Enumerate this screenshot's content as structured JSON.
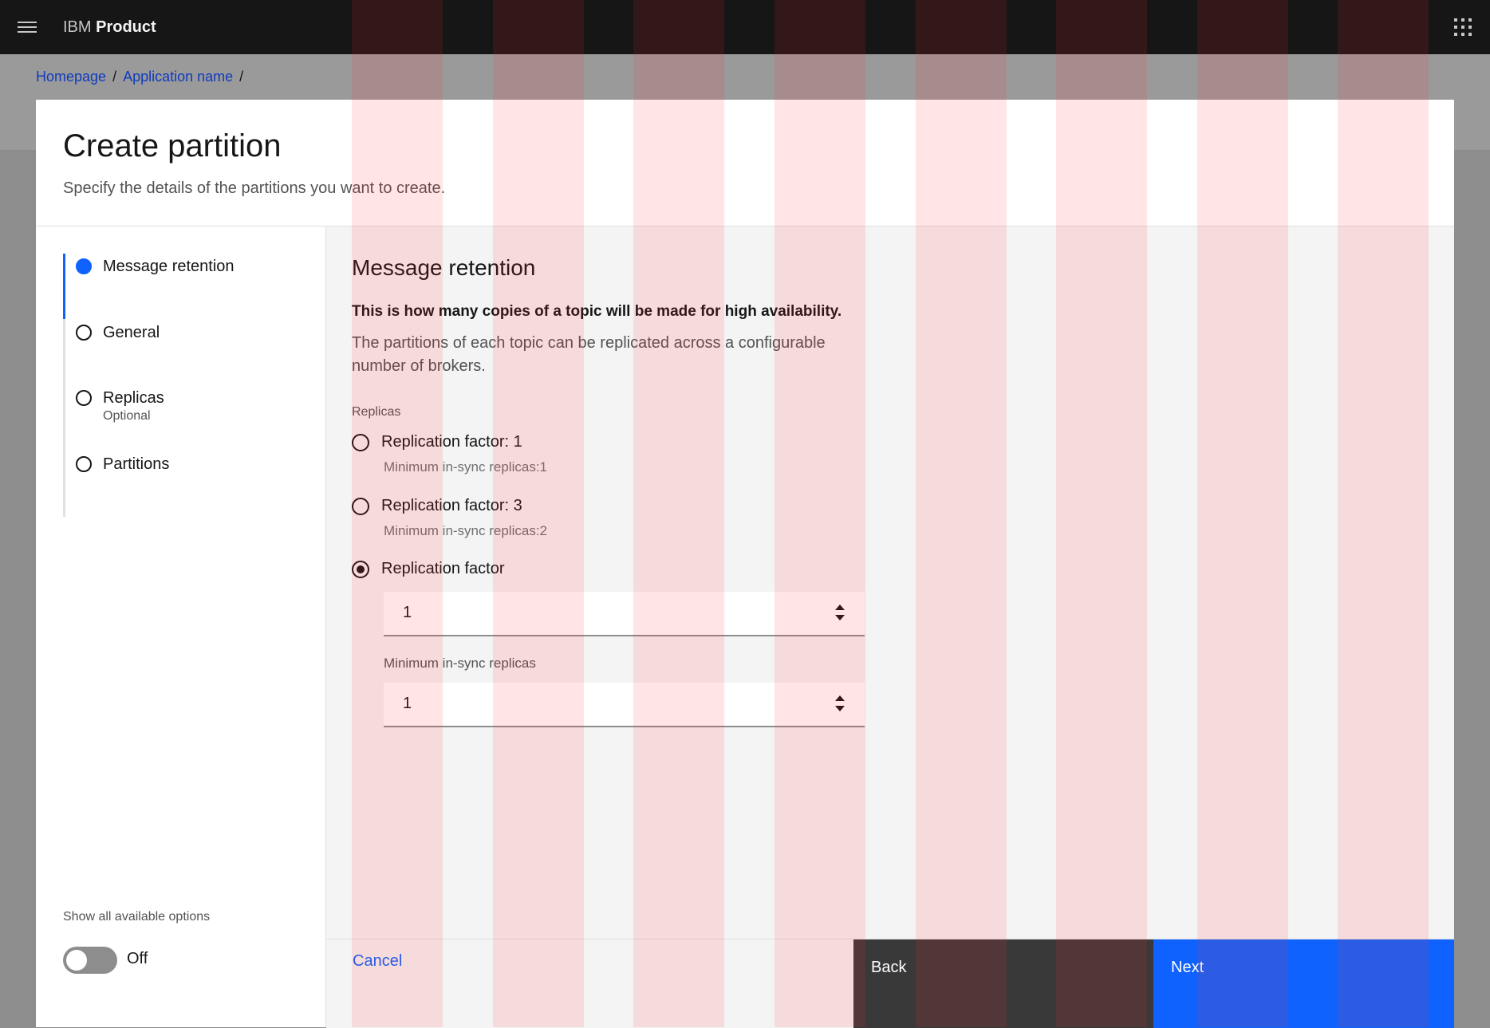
{
  "shell": {
    "product_prefix": "IBM",
    "product_name": "Product"
  },
  "breadcrumb": {
    "items": [
      "Homepage",
      "Application name"
    ],
    "separator": "/"
  },
  "modal": {
    "title": "Create partition",
    "subtitle": "Specify the details of the partitions you want to create."
  },
  "steps": [
    {
      "label": "Message retention",
      "state": "current"
    },
    {
      "label": "General",
      "state": "incomplete"
    },
    {
      "label": "Replicas",
      "sub": "Optional",
      "state": "incomplete"
    },
    {
      "label": "Partitions",
      "state": "incomplete"
    }
  ],
  "toggle": {
    "label": "Show all available options",
    "state": "Off"
  },
  "content": {
    "section_title": "Message retention",
    "bold_text": "This is how many copies of a topic will be made for high availability.",
    "description": "The partitions of each topic can be replicated across a configurable number of brokers.",
    "group_label": "Replicas",
    "options": [
      {
        "label": "Replication factor: 1",
        "helper": "Minimum in-sync replicas:1",
        "checked": false
      },
      {
        "label": "Replication factor: 3",
        "helper": "Minimum in-sync replicas:2",
        "checked": false
      },
      {
        "label": "Replication factor",
        "checked": true
      }
    ],
    "replication_value": "1",
    "min_label": "Minimum in-sync replicas",
    "min_value": "1"
  },
  "footer": {
    "cancel": "Cancel",
    "back": "Back",
    "next": "Next"
  },
  "colors": {
    "accent": "#0f62fe",
    "header_bg": "#161616",
    "grid_overlay": "#ff2828"
  }
}
